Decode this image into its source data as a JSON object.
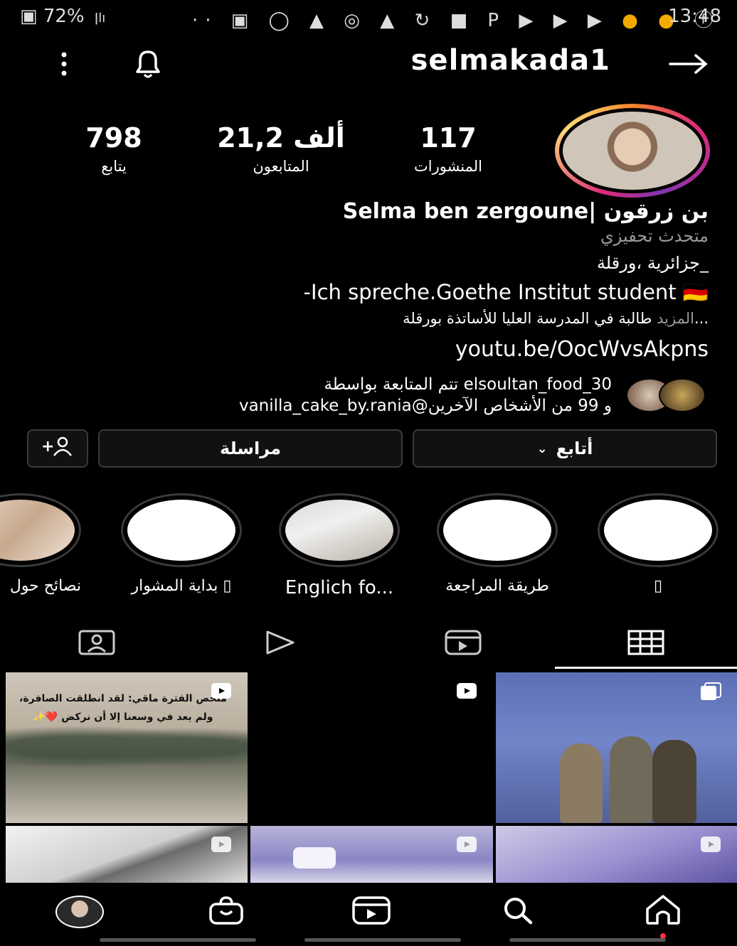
{
  "status_bar": {
    "battery": "72%",
    "signal": "lll",
    "icons": [
      "more-icon",
      "gallery-icon",
      "whatsapp-icon",
      "warning-icon",
      "instagram-icon",
      "app-icon",
      "sync-icon",
      "bag-icon",
      "pinterest-icon",
      "youtube-icon",
      "youtube-icon",
      "youtube-icon",
      "circle-icon",
      "circle-icon",
      "facebook-icon"
    ],
    "time": "13:48"
  },
  "header": {
    "username": "selmakada1"
  },
  "stats": [
    {
      "value": "798",
      "label": "يتابع"
    },
    {
      "value": "21,2 ألف",
      "label": "المتابعون"
    },
    {
      "value": "117",
      "label": "المنشورات"
    }
  ],
  "bio": {
    "name": "Selma ben zergoune| بن زرقون",
    "category": "متحدث تحفيزي",
    "line1": "جزائرية ،ورقلة_",
    "line2": "-Ich spreche.Goethe Institut student 🇩🇪",
    "line3": "طالبة في المدرسة العليا للأساتذة بورقلة...",
    "more": "المزيد",
    "link": "youtu.be/OocWvsAkpns",
    "followed_by_line1": "تتم المتابعة بواسطة elsoultan_food_30",
    "followed_by_line2": "vanilla_cake_by.rania@و 99 من الأشخاص الآخرين"
  },
  "actions": {
    "follow": "أتابع",
    "message": "مراسلة",
    "add_user": "+"
  },
  "highlights": [
    {
      "label": "نصائح حول"
    },
    {
      "label": "بداية المشوار ▯"
    },
    {
      "label": "Englich fo..."
    },
    {
      "label": "طريقة المراجعة"
    },
    {
      "label": "▯"
    }
  ],
  "tabs": [
    "tagged-tab",
    "video-tab",
    "reels-tab",
    "grid-tab"
  ],
  "grid": {
    "post1_text": "ملخص الفترة ماقي: لقد انطلقت الصافرة، ولم يعد في وسعنا إلا أن نركض ❤️✨"
  },
  "bottom_nav": [
    "profile",
    "shop",
    "reels",
    "search",
    "home"
  ],
  "colors": {
    "background": "#000000",
    "text": "#ffffff",
    "border": "#3a3a3a",
    "notification_dot": "#ff3040"
  }
}
